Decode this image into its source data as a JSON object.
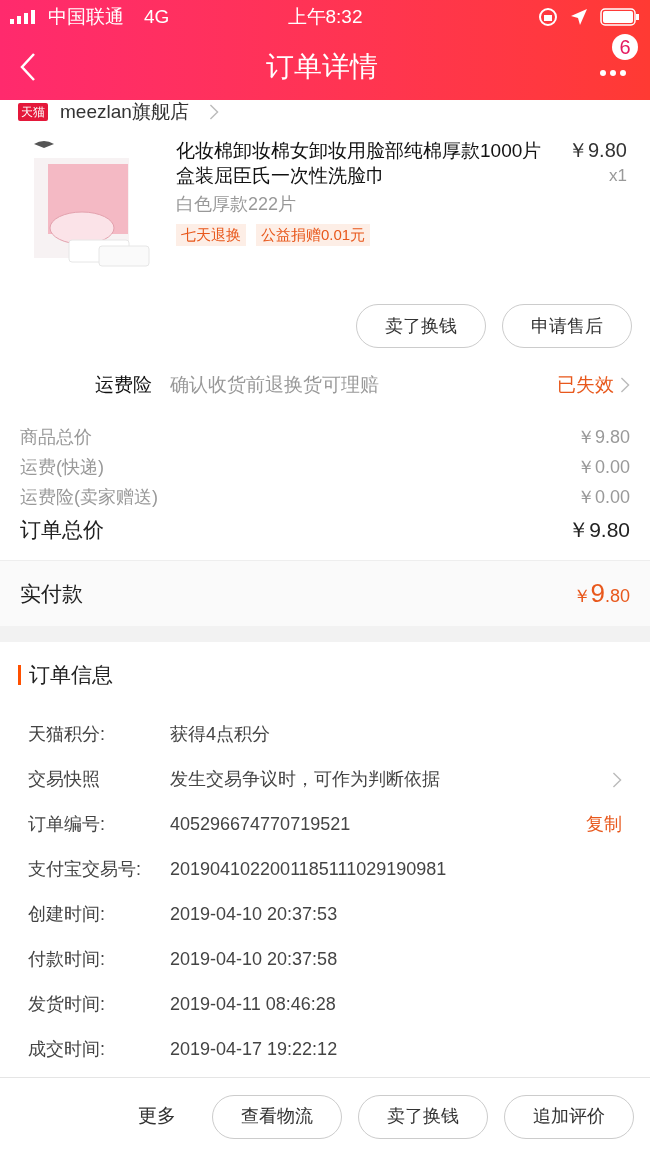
{
  "status_bar": {
    "carrier": "中国联通",
    "network": "4G",
    "time": "上午8:32"
  },
  "nav": {
    "title": "订单详情",
    "badge": "6"
  },
  "shop": {
    "platform": "天猫",
    "name": "meezlan旗舰店"
  },
  "product": {
    "title": "化妆棉卸妆棉女卸妆用脸部纯棉厚款1000片盒装屈臣氏一次性洗脸巾",
    "price": "￥9.80",
    "quantity": "x1",
    "variant": "白色厚款222片",
    "tags": [
      "七天退换",
      "公益捐赠0.01元"
    ],
    "actions": [
      "卖了换钱",
      "申请售后"
    ]
  },
  "insurance": {
    "label": "运费险",
    "description": "确认收货前退换货可理赔",
    "status": "已失效"
  },
  "fees": [
    {
      "label": "商品总价",
      "value": "￥9.80"
    },
    {
      "label": "运费(快递)",
      "value": "￥0.00"
    },
    {
      "label": "运费险(卖家赠送)",
      "value": "￥0.00"
    }
  ],
  "order_total": {
    "label": "订单总价",
    "value": "￥9.80"
  },
  "paid": {
    "label": "实付款",
    "currency": "￥",
    "integer": "9",
    "decimal": ".80"
  },
  "order_info": {
    "title": "订单信息",
    "rows": [
      {
        "label": "天猫积分:",
        "value": "获得4点积分"
      },
      {
        "label": "交易快照",
        "value": "发生交易争议时，可作为判断依据",
        "arrow": true
      },
      {
        "label": "订单编号:",
        "value": "405296674770719521",
        "action": "复制"
      },
      {
        "label": "支付宝交易号:",
        "value": "2019041022001185111029190981"
      },
      {
        "label": "创建时间:",
        "value": "2019-04-10 20:37:53"
      },
      {
        "label": "付款时间:",
        "value": "2019-04-10 20:37:58"
      },
      {
        "label": "发货时间:",
        "value": "2019-04-11 08:46:28"
      },
      {
        "label": "成交时间:",
        "value": "2019-04-17 19:22:12"
      }
    ]
  },
  "bottom_bar": {
    "more": "更多",
    "buttons": [
      "查看物流",
      "卖了换钱",
      "追加评价"
    ]
  }
}
